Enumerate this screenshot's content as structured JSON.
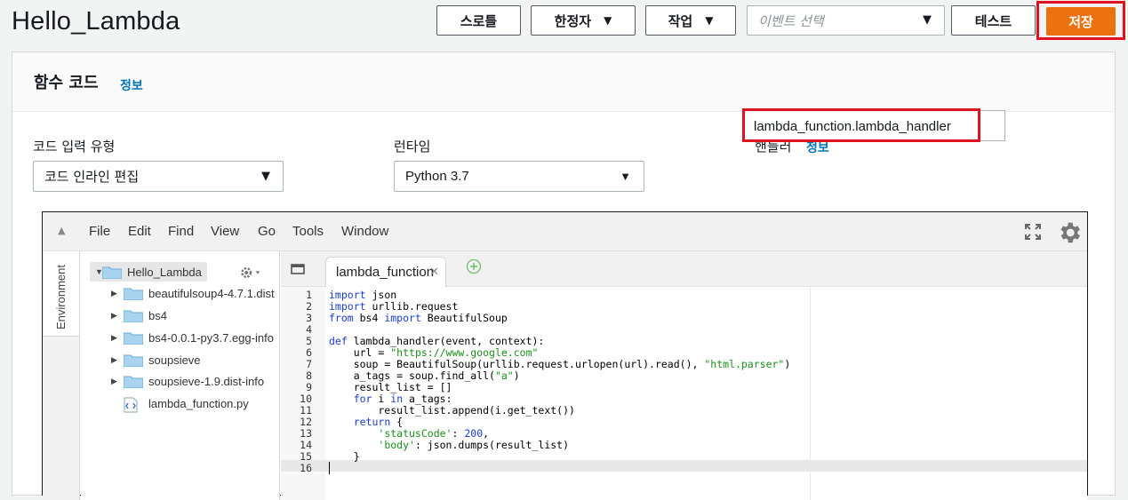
{
  "header": {
    "title": "Hello_Lambda",
    "buttons": {
      "throttle": "스로틀",
      "qualifiers": "한정자",
      "actions": "작업",
      "test": "테스트",
      "save": "저장"
    },
    "event_select_placeholder": "이벤트 선택"
  },
  "card": {
    "title": "함수 코드",
    "info": "정보",
    "fields": {
      "code_entry_label": "코드 입력 유형",
      "code_entry_value": "코드 인라인 편집",
      "runtime_label": "런타임",
      "runtime_value": "Python 3.7",
      "handler_label": "핸들러",
      "handler_info": "정보",
      "handler_value": "lambda_function.lambda_handler"
    }
  },
  "ide": {
    "menu": [
      "File",
      "Edit",
      "Find",
      "View",
      "Go",
      "Tools",
      "Window"
    ],
    "side_tab": "Environment",
    "tree": {
      "root": "Hello_Lambda",
      "items": [
        {
          "name": "beautifulsoup4-4.7.1.dist",
          "type": "folder"
        },
        {
          "name": "bs4",
          "type": "folder"
        },
        {
          "name": "bs4-0.0.1-py3.7.egg-info",
          "type": "folder"
        },
        {
          "name": "soupsieve",
          "type": "folder"
        },
        {
          "name": "soupsieve-1.9.dist-info",
          "type": "folder"
        },
        {
          "name": "lambda_function.py",
          "type": "file"
        }
      ]
    },
    "active_tab": "lambda_function",
    "code_lines": [
      "1",
      "2",
      "3",
      "4",
      "5",
      "6",
      "7",
      "8",
      "9",
      "10",
      "11",
      "12",
      "13",
      "14",
      "15",
      "16"
    ]
  },
  "colors": {
    "save_bg": "#ec7211",
    "highlight_border": "#e0121f",
    "link": "#0073bb"
  }
}
